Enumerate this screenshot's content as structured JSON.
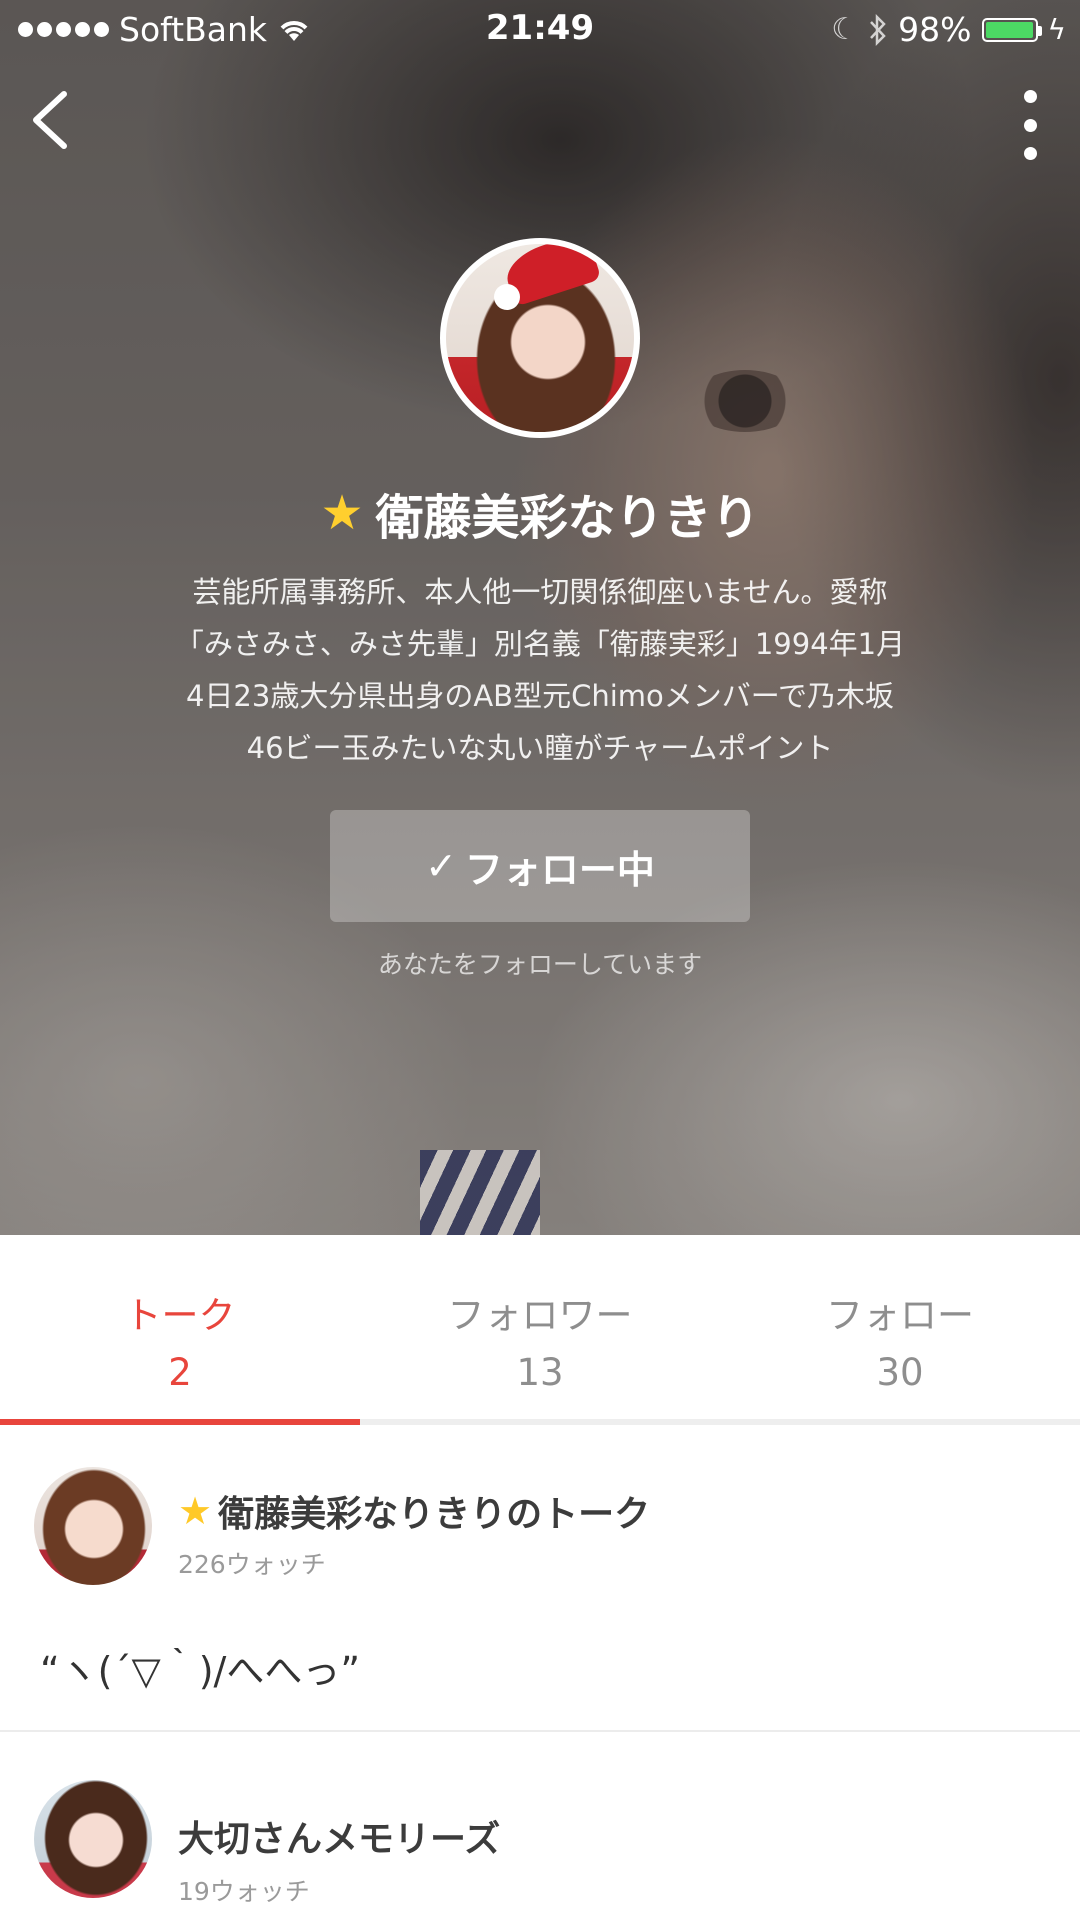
{
  "status_bar": {
    "carrier": "SoftBank",
    "time": "21:49",
    "battery": "98%",
    "battery_level": 0.98
  },
  "nav": {
    "back_icon": "chevron-left-icon",
    "more_icon": "vertical-ellipsis-icon"
  },
  "profile": {
    "name": "衛藤美彩なりきり",
    "badge_icon": "star-icon",
    "bio_lines": [
      "芸能所属事務所、本人他一切関係御座いません。愛称",
      "「みさみさ、みさ先輩」別名義「衛藤実彩」1994年1月",
      "4日23歳大分県出身のAB型元Chimoメンバーで乃木坂",
      "46ビー玉みたいな丸い瞳がチャームポイント"
    ],
    "follow_button_check": "✓",
    "follow_button_label": "フォロー中",
    "follow_note": "あなたをフォローしています"
  },
  "tabs": [
    {
      "label": "トーク",
      "count": "2",
      "active": true
    },
    {
      "label": "フォロワー",
      "count": "13",
      "active": false
    },
    {
      "label": "フォロー",
      "count": "30",
      "active": false
    }
  ],
  "talks": [
    {
      "title": "衛藤美彩なりきりのトーク",
      "has_star": true,
      "watch": "226ウォッチ",
      "snippet": "“ヽ(´▽｀)/へへっ”"
    },
    {
      "title": "大切さんメモリーズ",
      "has_star": false,
      "watch": "19ウォッチ",
      "snippet": ""
    }
  ],
  "colors": {
    "accent": "#e8453c",
    "battery": "#4cd964",
    "star": "#ffc928"
  }
}
